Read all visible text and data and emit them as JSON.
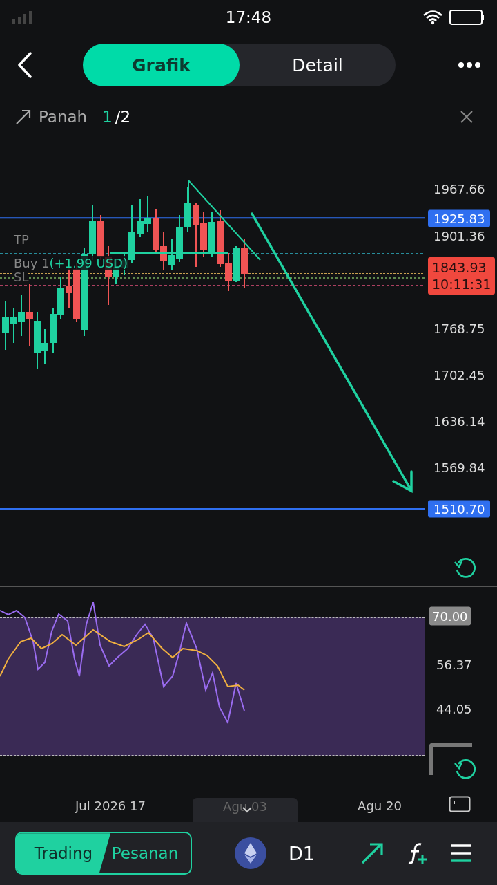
{
  "status_bar": {
    "time": "17:48"
  },
  "header": {
    "tabs": [
      {
        "label": "Grafik",
        "selected": true
      },
      {
        "label": "Detail",
        "selected": false
      }
    ]
  },
  "drawing_tool": {
    "name": "Panah",
    "current": "1",
    "total": "/2"
  },
  "chart": {
    "price_labels": [
      {
        "text": "1967.66",
        "kind": "plain"
      },
      {
        "text": "1925.83",
        "kind": "line"
      },
      {
        "text": "1901.36",
        "kind": "plain"
      },
      {
        "text": "1843.93",
        "kind": "last",
        "countdown": "10:11:31"
      },
      {
        "text": "1768.75",
        "kind": "plain"
      },
      {
        "text": "1702.45",
        "kind": "plain"
      },
      {
        "text": "1636.14",
        "kind": "plain"
      },
      {
        "text": "1569.84",
        "kind": "plain"
      },
      {
        "text": "1510.70",
        "kind": "line"
      }
    ],
    "order_lines": [
      {
        "label": "TP"
      },
      {
        "label": "Buy 1",
        "profit": "(+1.99 USD)"
      },
      {
        "label": "SL"
      }
    ]
  },
  "rsi": {
    "labels": [
      {
        "text": "70.00",
        "kind": "boxed"
      },
      {
        "text": "56.37",
        "kind": "plain"
      },
      {
        "text": "44.05",
        "kind": "plain"
      }
    ]
  },
  "time_axis": [
    {
      "text": "Jul 2026 17",
      "selected": false
    },
    {
      "text": "Agu 03",
      "selected": true
    },
    {
      "text": "Agu 20",
      "selected": false
    }
  ],
  "bottom_bar": {
    "mode_tabs": [
      {
        "label": "Trading",
        "selected": true
      },
      {
        "label": "Pesanan",
        "selected": false
      }
    ],
    "timeframe": "D1"
  }
}
